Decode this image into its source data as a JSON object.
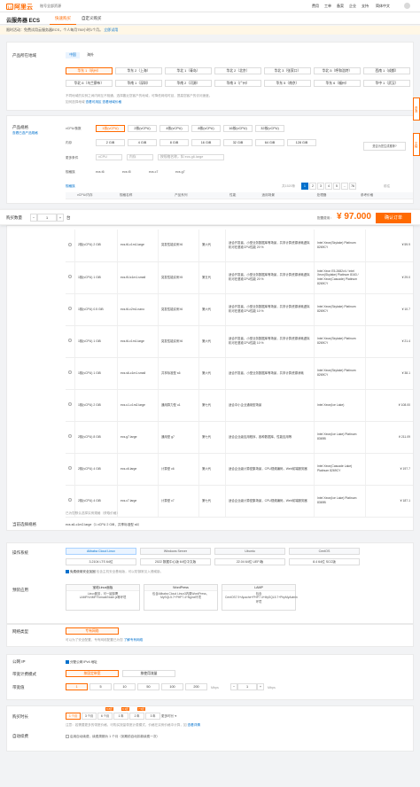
{
  "topbar": {
    "logo_text": "阿里云",
    "logo_icon": "bracket-logo-icon",
    "workspace": "账号全部资源",
    "nav": [
      "费用",
      "工单",
      "备案",
      "企业",
      "支持",
      "简体中文"
    ]
  },
  "header": {
    "title": "云服务器 ECS",
    "tabs": [
      "快速购买",
      "自定义购买"
    ],
    "active_tab": 0
  },
  "notice": {
    "text": "限时活动：免费试用云服务器ECS，个人每月750小时1个月。",
    "link": "立即试用"
  },
  "region": {
    "label": "产品所在地域",
    "tabs": [
      "中国",
      "海外"
    ],
    "active": 0,
    "row1": [
      "华东 1（杭州）",
      "华东 2（上海）",
      "华北 1（青岛）",
      "华北 2（北京）",
      "华北 3（张家口）",
      "华北 5（呼和浩特）",
      "西南 1（成都）"
    ],
    "row2": [
      "华北 6（乌兰察布）",
      "华南 1（深圳）",
      "华南 2（河源）",
      "华南 3（广州）",
      "华东 5（南京）",
      "华东 6（福州）",
      "华中 1（武汉）"
    ],
    "active_index": 0,
    "hint1": "不同地域的实例之间内网互不相通，选择靠近您客户的地域，可降低网络时延，提高您客户的访问速度。",
    "hint2": "如何选择地域",
    "hint_link": "查看可用区",
    "hint_link2": "查看地域价格"
  },
  "spec": {
    "label": "产品规格",
    "sublabel": "查看已选产品规格",
    "vcpu_label": "vCPU/核数",
    "vcpu": [
      "1核(vCPU)",
      "2核(vCPU)",
      "4核(vCPU)",
      "8核(vCPU)",
      "16核(vCPU)",
      "32核(vCPU)"
    ],
    "mem_label": "内存",
    "mem": [
      "2 GiB",
      "4 GiB",
      "8 GiB",
      "16 GiB",
      "32 GiB",
      "64 GiB",
      "128 GiB"
    ],
    "more_label": "更多条件",
    "inputs": [
      "vCPU",
      "内存",
      "按规格名称，如 ecs.g6.large"
    ],
    "family_label": "规格族",
    "families": [
      "ecs.t6",
      "ecs.t5",
      "ecs.c7",
      "ecs.g7"
    ],
    "pager": {
      "count": "共1520条",
      "pages": [
        "1",
        "2",
        "3",
        "4",
        "5",
        "...",
        "76"
      ],
      "active": "1",
      "jump": "前往"
    },
    "col_hint": "规格族",
    "columns": [
      "vCPU/内存",
      "规格名称",
      "产品系列",
      "性能",
      "适用场景",
      "处理器",
      "参考价格"
    ],
    "rows": [
      {
        "cpu": "2核(vCPU) 2 GiB",
        "name": "ecs.t6-c1m1.large",
        "family": "突发性能实例 t6",
        "gen": "第六代",
        "scene": "适合开发者、小型业务数据库等场景，共享计算资源消耗虚拟机可在基准CPU性能 20 %",
        "proc": "Intel Xeon(Skylake) Platinum 8269CY",
        "price": "¥ 59.9"
      },
      {
        "cpu": "1核(vCPU) 1 GiB",
        "name": "ecs.t5-lc1m1.small",
        "family": "突发性能实例 t5",
        "gen": "第五代",
        "scene": "适合开发者、小型业务数据库等场景，共享计算资源消耗虚拟机可在基准CPU性能 20 %",
        "proc": "Intel Xeon E5-2682v4 / Intel Xeon(Skylake) Platinum 8163 / Intel Xeon(Cascade) Platinum 8269CY",
        "price": "¥ 29.0"
      },
      {
        "cpu": "1核(vCPU) 0.5 GiB",
        "name": "ecs.t6-c2m1.nano",
        "family": "突发性能实例 t6",
        "gen": "第六代",
        "scene": "适合开发者、小型业务数据库等场景，共享计算资源消耗虚拟机可在基准CPU性能 10 %",
        "proc": "Intel Xeon(Skylake) Platinum 8269CY",
        "price": "¥ 10.7"
      },
      {
        "cpu": "1核(vCPU) 1 GiB",
        "name": "ecs.t6-c1m1.large",
        "family": "突发性能实例 t6",
        "gen": "第六代",
        "scene": "适合开发者、小型业务数据库等场景，共享计算资源消耗虚拟机可在基准CPU性能 10 %",
        "proc": "Intel Xeon(Skylake) Platinum 8269CY",
        "price": "¥ 21.4"
      },
      {
        "cpu": "1核(vCPU) 1 GiB",
        "name": "ecs.s6-c1m1.small",
        "family": "共享标准型 s6",
        "gen": "第六代",
        "scene": "适合开发者、小型业务数据库等场景，共享计算资源消耗",
        "proc": "Intel Xeon(Skylake) Platinum 8269CY",
        "price": "¥ 38.1"
      },
      {
        "cpu": "1核(vCPU) 2 GiB",
        "name": "ecs.u1-c1m2.large",
        "family": "通用算力型 u1",
        "gen": "第七代",
        "scene": "适合中小企业通用型场景",
        "proc": "Intel Xeon(Ice Lake)",
        "price": "¥ 108.00"
      },
      {
        "cpu": "2核(vCPU) 8 GiB",
        "name": "ecs.g7.large",
        "family": "通用型 g7",
        "gen": "第七代",
        "scene": "适合企业级应用程序，各种数据库、性能应用等",
        "proc": "Intel Xeon(Ice Lake) Platinum 8369B",
        "price": "¥ 211.09"
      },
      {
        "cpu": "2核(vCPU) 4 GiB",
        "name": "ecs.c6.large",
        "family": "计算型 c6",
        "gen": "第六代",
        "scene": "适合企业级计算密集场景，CPU视频编码，Web前端服务器",
        "proc": "Intel Xeon(Cascade Lake) Platinum 8269CY",
        "price": "¥ 197.7"
      },
      {
        "cpu": "2核(vCPU) 4 GiB",
        "name": "ecs.c7.large",
        "family": "计算型 c7",
        "gen": "第七代",
        "scene": "适合企业级计算密集场景，CPU视频编码，Web前端服务器",
        "proc": "Intel Xeon(Ice Lake) Platinum 8369B",
        "price": "¥ 187.1"
      }
    ],
    "footer_hint": "已为您默认选择实例规格（获取价格）",
    "current_label": "当前选择规格",
    "current_value": "ecs.s6-c1m2.large（1 vCPU 2 GiB，共享标准型 s6）"
  },
  "sticky": {
    "qty_label": "购买数量",
    "qty": "1",
    "unit": "台",
    "price_label": "配置费用：",
    "price": "¥ 97.000",
    "order_btn": "确认订单"
  },
  "side": {
    "items": [
      "咨询",
      "文档"
    ]
  },
  "side_tip": "是否为您生成推荐?",
  "os": {
    "label": "操作系统",
    "tabs": [
      "Alibaba Cloud Linux",
      "Windows Server",
      "Ubuntu",
      "CentOS"
    ],
    "active": 0,
    "versions": [
      "3.2104 LTS 64位",
      "2022 数据中心版 64位中文版",
      "22.04 64位 UEFI版",
      "8.4 64位 SCC版"
    ],
    "check": "免费使用安全加固",
    "check_hint": "包含主机安全基础版，可以防御常见入侵威胁。"
  },
  "apps": {
    "label": "预装应用",
    "cards": [
      {
        "h": "宝塔Linux面板",
        "d": "Linux服务，可一键部署LAMP/LNMP/Tomcat/Node.js等环境"
      },
      {
        "h": "WordPress",
        "d": "包含Alibaba Cloud Linux3内置WordPress、MySQL5.7+PHP7.4+Nginx环境"
      },
      {
        "h": "LAMP",
        "d": "包含CentOS7.9+Apache+PHP7.4+MySQL5.7+PhpMyAdmin环境"
      }
    ]
  },
  "network": {
    "label": "网络类型",
    "value": "专有网络",
    "hint": "可以为了安全配置，专有网络配置已为您",
    "hint_link": "了解专有网络"
  },
  "ip": {
    "label": "公网 IP",
    "check": "分配公网 IPv4 地址",
    "bill_label": "带宽计费模式",
    "bill": [
      "按固定带宽",
      "按使用流量"
    ],
    "active_bill": 0,
    "bw_label": "带宽值",
    "bw": [
      "1",
      "5",
      "10",
      "50",
      "100",
      "200"
    ],
    "bw_unit": "Mbps",
    "bw_value": "1",
    "bw_unit2": "Mbps"
  },
  "duration": {
    "label": "购买时长",
    "options": [
      "1 个月",
      "3 个月",
      "6 个月",
      "1 年",
      "2 年",
      "3 年"
    ],
    "badges": [
      "8.8折",
      "8.3折",
      "7.5折"
    ],
    "more": "更多时长",
    "hint": "注意：若需要更多的带宽价格，可购买按量带宽计费模式，价格在实例价格中计算，如",
    "hint_link": "查看详情"
  },
  "renew": {
    "label": "自动续费",
    "check": "启用自动续费，续费周期为 1 个月（到期前自动扣款续费一次）"
  },
  "colors": {
    "accent": "#ff6a00",
    "link": "#0070cc"
  }
}
